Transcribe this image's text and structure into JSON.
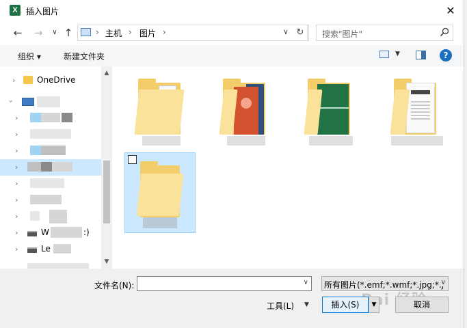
{
  "window": {
    "title": "插入图片",
    "app_icon_letter": "X"
  },
  "nav": {
    "back": "←",
    "forward": "→",
    "recent": "∨",
    "up": "↑",
    "breadcrumb": [
      "主机",
      "图片"
    ],
    "refresh": "↻",
    "search_placeholder": "搜索\"图片\""
  },
  "toolbar": {
    "organize": "组织 ▾",
    "new_folder": "新建文件夹",
    "help": "?"
  },
  "sidebar": {
    "items": [
      {
        "label": "OneDrive"
      },
      {
        "label": ""
      },
      {
        "label": "W"
      },
      {
        "label": "Le"
      }
    ],
    "drive_suffix": ":)"
  },
  "bottom": {
    "filename_label": "文件名(N):",
    "filename_value": "",
    "filter": "所有图片(*.emf;*.wmf;*.jpg;*.j",
    "tools": "工具(L)",
    "insert": "插入(S)",
    "cancel": "取消",
    "watermark": "Bai 经验"
  },
  "colors": {
    "accent": "#0078d7",
    "folder": "#f2cd6a",
    "selection": "#cce8ff"
  }
}
